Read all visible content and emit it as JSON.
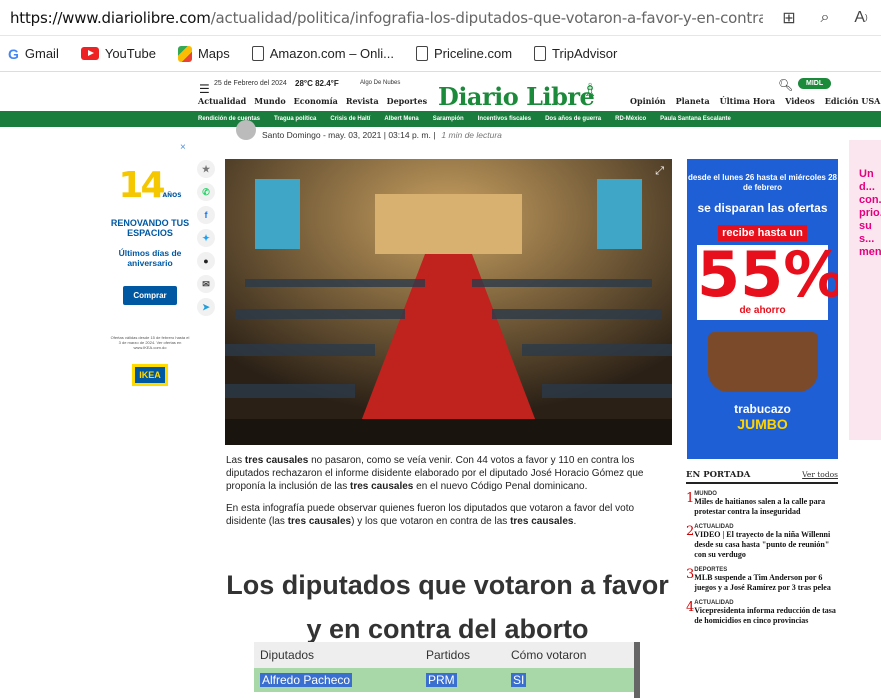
{
  "browser": {
    "url_domain": "https://www.diariolibre.com",
    "url_path": "/actualidad/politica/infografia-los-diputados-que-votaron-a-favor-y-en-contra-de-las-tre..."
  },
  "bookmarks": [
    {
      "label": "Gmail",
      "icon": "gmail-icon"
    },
    {
      "label": "YouTube",
      "icon": "youtube-icon"
    },
    {
      "label": "Maps",
      "icon": "maps-icon"
    },
    {
      "label": "Amazon.com – Onli...",
      "icon": "page-icon"
    },
    {
      "label": "Priceline.com",
      "icon": "page-icon"
    },
    {
      "label": "TripAdvisor",
      "icon": "page-icon"
    }
  ],
  "site": {
    "date": "25 de Febrero del 2024",
    "weather": "28°C 82.4°F",
    "weather_desc": "Algo De Nubes",
    "logo": "Diario Libre",
    "midl": "MIDL",
    "nav_left": [
      "Actualidad",
      "Mundo",
      "Economía",
      "Revista",
      "Deportes"
    ],
    "nav_right": [
      "Opinión",
      "Planeta",
      "Última Hora",
      "Videos",
      "Edición USA"
    ],
    "topics": [
      "Rendición de cuentas",
      "Tragua política",
      "Crisis de Haití",
      "Albert Mena",
      "Sarampión",
      "Incentivos fiscales",
      "Dos años de guerra",
      "RD-México",
      "Paula Santana Escalante"
    ]
  },
  "byline": {
    "place_date": "Santo Domingo - may. 03, 2021 | 03:14 p. m. |",
    "read_time": "1 min de lectura"
  },
  "left_ad": {
    "big": "14",
    "small": "AÑOS",
    "line1": "RENOVANDO TUS ESPACIOS",
    "line2": "Últimos días de aniversario",
    "button": "Comprar",
    "fine": "Ofertas válidas desde 15 de febrero hasta el 3 de marzo de 2024. Ver ofertas en www.IKEA.com.do",
    "brand": "IKEA"
  },
  "article": {
    "p1_a": "Las ",
    "p1_b": "tres causales",
    "p1_c": " no pasaron, como se veía venir. Con 44 votos a favor y 110 en contra los diputados rechazaron el informe disidente elaborado por el diputado José Horacio Gómez que proponía la inclusión de las ",
    "p1_d": "tres causales",
    "p1_e": " en el nuevo Código Penal dominicano.",
    "p2_a": "En esta infografía puede observar quienes fueron los diputados que votaron a favor del voto disidente (las ",
    "p2_b": "tres causales",
    "p2_c": ") y los que votaron en contra de las ",
    "p2_d": "tres causales",
    "p2_e": ".",
    "infog_title": "Los diputados que votaron a favor y en contra del aborto"
  },
  "table": {
    "headers": [
      "Diputados",
      "Partidos",
      "Cómo votaron"
    ],
    "rows": [
      [
        "Alfredo Pacheco",
        "PRM",
        "SI"
      ]
    ]
  },
  "right_ad": {
    "t1": "desde el lunes 26 hasta el miércoles 28 de febrero",
    "t2": "se disparan las ofertas",
    "t3": "recibe hasta un",
    "big": "55%",
    "t4": "de ahorro",
    "t5": "trabucazo",
    "t6": "JUMBO"
  },
  "far_right": {
    "text": "Un d... con... prio... su s... men..."
  },
  "portada": {
    "title": "EN PORTADA",
    "link": "Ver todos",
    "items": [
      {
        "num": "1",
        "cat": "MUNDO",
        "title": "Miles de haitianos salen a la calle para protestar contra la inseguridad"
      },
      {
        "num": "2",
        "cat": "ACTUALIDAD",
        "title": "VIDEO | El trayecto de la niña Willenni desde su casa hasta \"punto de reunión\" con su verdugo"
      },
      {
        "num": "3",
        "cat": "DEPORTES",
        "title": "MLB suspende a Tim Anderson por 6 juegos y a José Ramírez por 3 tras pelea"
      },
      {
        "num": "4",
        "cat": "ACTUALIDAD",
        "title": "Vicepresidenta informa reducción de tasa de homicidios en cinco provincias"
      }
    ]
  }
}
